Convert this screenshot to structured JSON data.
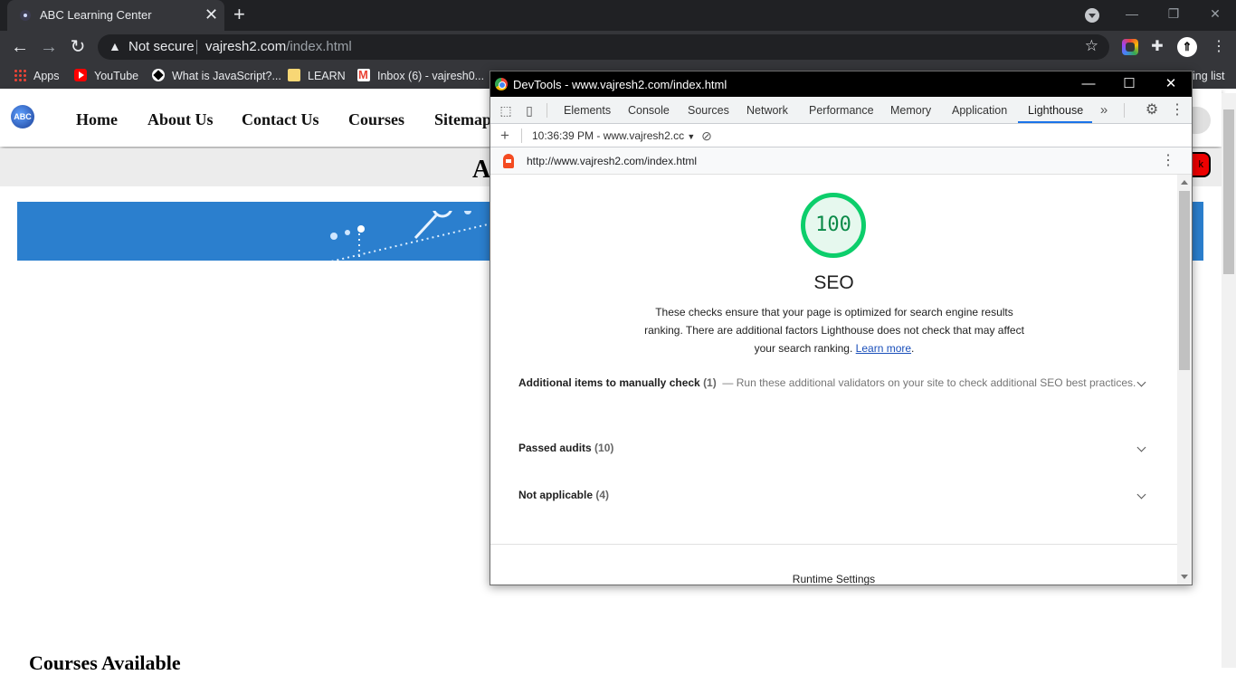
{
  "browser": {
    "tab_title": "ABC Learning Center",
    "address_security": "Not secure",
    "address_host": "vajresh2.com",
    "address_path": "/index.html",
    "bookmarks": [
      {
        "label": "Apps",
        "icon": "apps-grid-icon"
      },
      {
        "label": "YouTube",
        "icon": "youtube-icon"
      },
      {
        "label": "What is JavaScript?...",
        "icon": "javascript-icon"
      },
      {
        "label": "LEARN",
        "icon": "folder-icon"
      },
      {
        "label": "Inbox (6) - vajresh0...",
        "icon": "gmail-icon"
      }
    ],
    "reading_list_fragment": "ing list"
  },
  "site": {
    "logo_text": "ABC",
    "nav": [
      "Home",
      "About Us",
      "Contact Us",
      "Courses",
      "Sitemap"
    ],
    "heading_fragment": "A",
    "button_fragment": "k",
    "courses_heading": "Courses Available"
  },
  "devtools": {
    "window_title": "DevTools - www.vajresh2.com/index.html",
    "tabs": [
      "Elements",
      "Console",
      "Sources",
      "Network",
      "Performance",
      "Memory",
      "Application",
      "Lighthouse"
    ],
    "active_tab": "Lighthouse",
    "report_select": "10:36:39 PM - www.vajresh2.cc",
    "report_url": "http://www.vajresh2.com/index.html",
    "score": "100",
    "category_title": "SEO",
    "description": "These checks ensure that your page is optimized for search engine results ranking. There are additional factors Lighthouse does not check that may affect your search ranking.",
    "learn_more": "Learn more",
    "groups": [
      {
        "title": "Additional items to manually check",
        "count": "(1)",
        "separator": "—",
        "description": "Run these additional validators on your site to check additional SEO best practices."
      },
      {
        "title": "Passed audits",
        "count": "(10)"
      },
      {
        "title": "Not applicable",
        "count": "(4)"
      }
    ],
    "runtime_settings": "Runtime Settings"
  },
  "colors": {
    "score_green": "#0cce6b",
    "active_tab_blue": "#1a73e8",
    "banner_blue": "#2b7fce"
  }
}
